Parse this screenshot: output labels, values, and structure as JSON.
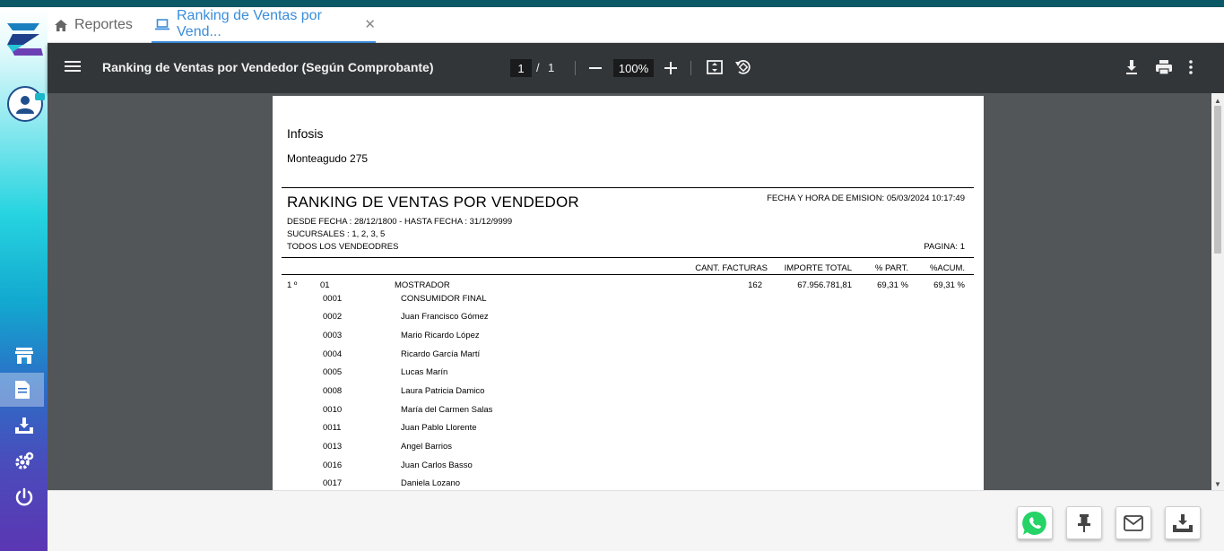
{
  "tabs": [
    {
      "label": "Reportes",
      "icon": "home-icon"
    },
    {
      "label": "Ranking de Ventas por Vend...",
      "icon": "laptop-icon",
      "active": true
    }
  ],
  "toolbar": {
    "title": "Ranking de Ventas por Vendedor (Según Comprobante)",
    "page_current": "1",
    "page_separator": "/",
    "page_total": "1",
    "zoom": "100%"
  },
  "report": {
    "company": "Infosis",
    "address": "Monteagudo 275",
    "title": "RANKING DE VENTAS POR VENDEDOR",
    "emission": "FECHA Y HORA DE EMISION: 05/03/2024 10:17:49",
    "date_range": "DESDE FECHA : 28/12/1800 - HASTA FECHA : 31/12/9999",
    "branches": "SUCURSALES : 1, 2, 3, 5",
    "sellers": "TODOS LOS VENDEODRES",
    "page_label": "PAGINA: 1",
    "columns": [
      "CANT. FACTURAS",
      "IMPORTE TOTAL",
      "% PART.",
      "%ACUM."
    ],
    "rows": [
      {
        "rank": "1 º",
        "code": "01",
        "name": "MOSTRADOR",
        "invoices": "162",
        "total": "67.956.781,81",
        "part": "69,31 %",
        "acum": "69,31 %"
      }
    ],
    "vendors": [
      {
        "code": "0001",
        "name": "CONSUMIDOR FINAL"
      },
      {
        "code": "0002",
        "name": "Juan Francisco Gómez"
      },
      {
        "code": "0003",
        "name": "Mario Ricardo López"
      },
      {
        "code": "0004",
        "name": "Ricardo García Martí"
      },
      {
        "code": "0005",
        "name": "Lucas Marín"
      },
      {
        "code": "0008",
        "name": "Laura Patricia Damico"
      },
      {
        "code": "0010",
        "name": "María del Carmen Salas"
      },
      {
        "code": "0011",
        "name": "Juan Pablo Llorente"
      },
      {
        "code": "0013",
        "name": "Angel Barrios"
      },
      {
        "code": "0016",
        "name": "Juan Carlos Basso"
      },
      {
        "code": "0017",
        "name": "Daniela Lozano"
      }
    ]
  },
  "sidebar": {
    "items": [
      "store-icon",
      "document-icon",
      "download-tray-icon",
      "settings-icon",
      "power-icon"
    ]
  },
  "actions": [
    "whatsapp-icon",
    "pin-icon",
    "email-icon",
    "download-icon"
  ],
  "colors": {
    "accent": "#3a8ddb",
    "toolbar": "#323639",
    "viewer": "#525659",
    "whatsapp": "#25d366"
  }
}
